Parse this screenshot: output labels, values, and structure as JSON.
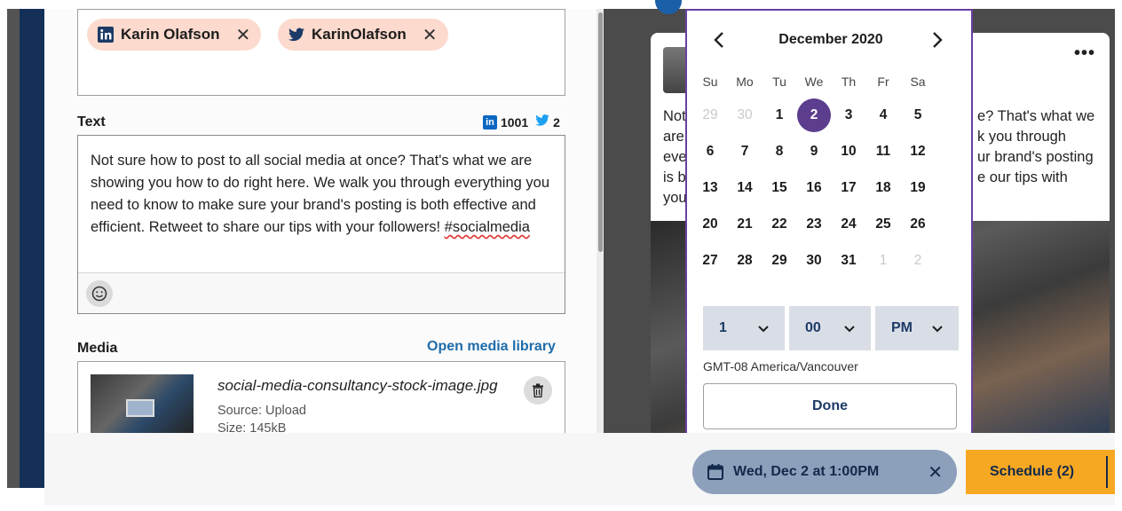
{
  "profiles": {
    "chips": [
      {
        "network": "linkedin",
        "icon": "linkedin-icon",
        "name": "Karin Olafson"
      },
      {
        "network": "twitter",
        "icon": "twitter-icon",
        "name": "KarinOlafson"
      }
    ]
  },
  "text_section": {
    "label": "Text",
    "linkedin_count": "1001",
    "twitter_count": "2",
    "body_main": "Not sure how to post to all social media at once? That's what we are showing you how to do right here. We walk you through everything you need to know to make sure your brand's posting is both effective and efficient. Retweet to share our tips with your followers! ",
    "body_tag": "#socialmedia"
  },
  "media_section": {
    "label": "Media",
    "open_library": "Open media library",
    "file_name": "social-media-consultancy-stock-image.jpg",
    "source": "Source: Upload",
    "size": "Size: 145kB"
  },
  "preview": {
    "lines": [
      "Not",
      "are",
      "eve",
      "is b",
      "you"
    ],
    "right_lines": [
      "e? That's what we",
      "k you through",
      "ur brand's posting",
      "e our tips with"
    ]
  },
  "calendar": {
    "month": "December 2020",
    "weekdays": [
      "Su",
      "Mo",
      "Tu",
      "We",
      "Th",
      "Fr",
      "Sa"
    ],
    "weeks": [
      [
        "29",
        "30",
        "1",
        "2",
        "3",
        "4",
        "5"
      ],
      [
        "6",
        "7",
        "8",
        "9",
        "10",
        "11",
        "12"
      ],
      [
        "13",
        "14",
        "15",
        "16",
        "17",
        "18",
        "19"
      ],
      [
        "20",
        "21",
        "22",
        "23",
        "24",
        "25",
        "26"
      ],
      [
        "27",
        "28",
        "29",
        "30",
        "31",
        "1",
        "2"
      ]
    ],
    "muted": [
      [
        0,
        0
      ],
      [
        0,
        1
      ],
      [
        4,
        5
      ],
      [
        4,
        6
      ]
    ],
    "selected": [
      0,
      3
    ],
    "hour": "1",
    "minute": "00",
    "ampm": "PM",
    "timezone": "GMT-08 America/Vancouver",
    "done_label": "Done"
  },
  "footer": {
    "scheduled_date": "Wed, Dec 2 at 1:00PM",
    "schedule_label": "Schedule (2)"
  },
  "colors": {
    "accent_purple": "#5c3d8e",
    "schedule_orange": "#f7a823",
    "navy": "#13294b",
    "chip_peach": "#fcdacd"
  }
}
